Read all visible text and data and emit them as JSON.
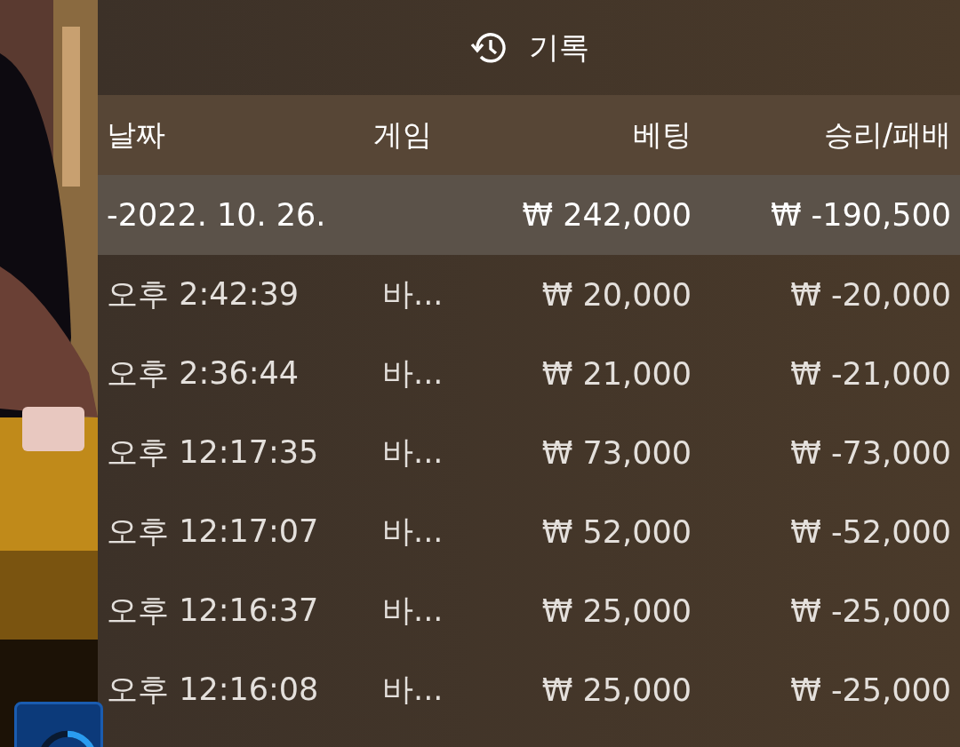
{
  "panel": {
    "title": "기록"
  },
  "table": {
    "columns": [
      "날짜",
      "게임",
      "베팅",
      "승리/패배"
    ],
    "group": {
      "date": "-2022. 10. 26.",
      "bet": "₩ 242,000",
      "result": "₩ -190,500"
    },
    "rows": [
      {
        "time": "오후 2:42:39",
        "game": "바...",
        "bet": "₩ 20,000",
        "result": "₩ -20,000"
      },
      {
        "time": "오후 2:36:44",
        "game": "바...",
        "bet": "₩ 21,000",
        "result": "₩ -21,000"
      },
      {
        "time": "오후 12:17:35",
        "game": "바...",
        "bet": "₩ 73,000",
        "result": "₩ -73,000"
      },
      {
        "time": "오후 12:17:07",
        "game": "바...",
        "bet": "₩ 52,000",
        "result": "₩ -52,000"
      },
      {
        "time": "오후 12:16:37",
        "game": "바...",
        "bet": "₩ 25,000",
        "result": "₩ -25,000"
      },
      {
        "time": "오후 12:16:08",
        "game": "바...",
        "bet": "₩ 25,000",
        "result": "₩ -25,000"
      }
    ]
  }
}
